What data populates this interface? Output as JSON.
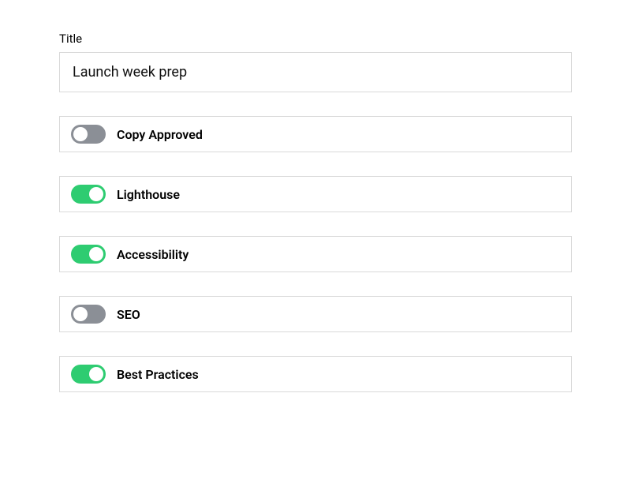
{
  "title_field": {
    "label": "Title",
    "value": "Launch week prep"
  },
  "toggles": [
    {
      "label": "Copy Approved",
      "on": false
    },
    {
      "label": "Lighthouse",
      "on": true
    },
    {
      "label": "Accessibility",
      "on": true
    },
    {
      "label": "SEO",
      "on": false
    },
    {
      "label": "Best Practices",
      "on": true
    }
  ]
}
